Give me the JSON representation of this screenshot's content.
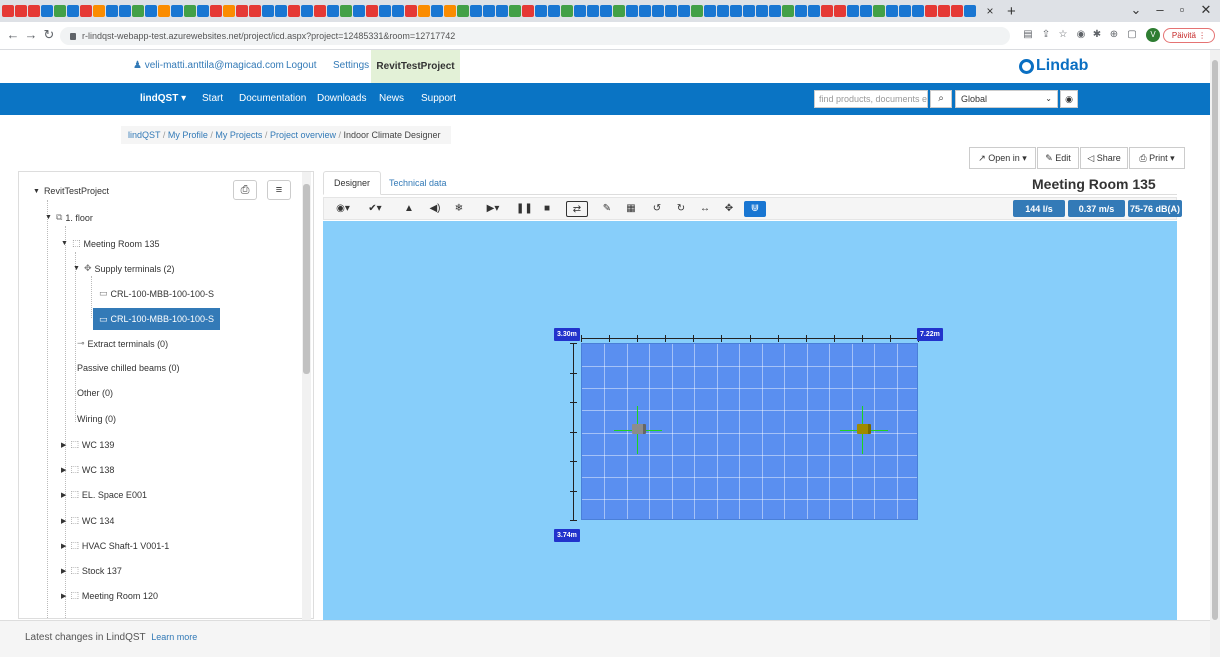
{
  "browser": {
    "url": "r-lindqst-webapp-test.azurewebsites.net/project/icd.aspx?project=12485331&room=12717742",
    "tab_close": "×",
    "new_tab": "+",
    "update_label": "Päivitä",
    "avatar_letter": "V",
    "tab_icon_colors": [
      "#e53935",
      "#e53935",
      "#e53935",
      "#1976d2",
      "#43a047",
      "#1976d2",
      "#e53935",
      "#fb8c00",
      "#1976d2",
      "#1976d2",
      "#43a047",
      "#1976d2",
      "#fb8c00",
      "#1976d2",
      "#43a047",
      "#1976d2",
      "#e53935",
      "#fb8c00",
      "#e53935",
      "#e53935",
      "#1976d2",
      "#1976d2",
      "#e53935",
      "#1976d2",
      "#e53935",
      "#1976d2",
      "#43a047",
      "#1976d2",
      "#e53935",
      "#1976d2",
      "#1976d2",
      "#e53935",
      "#fb8c00",
      "#1976d2",
      "#fb8c00",
      "#43a047",
      "#1976d2",
      "#1976d2",
      "#1976d2",
      "#43a047",
      "#e53935",
      "#1976d2",
      "#1976d2",
      "#43a047",
      "#1976d2",
      "#1976d2",
      "#1976d2",
      "#43a047",
      "#1976d2",
      "#1976d2",
      "#1976d2",
      "#1976d2",
      "#1976d2",
      "#43a047",
      "#1976d2",
      "#1976d2",
      "#1976d2",
      "#1976d2",
      "#1976d2",
      "#1976d2",
      "#43a047",
      "#1976d2",
      "#1976d2",
      "#e53935",
      "#e53935",
      "#1976d2",
      "#1976d2",
      "#43a047",
      "#1976d2",
      "#1976d2",
      "#1976d2",
      "#e53935",
      "#e53935",
      "#e53935",
      "#1976d2"
    ]
  },
  "header": {
    "user": "veli-matti.anttila@magicad.com",
    "logout": "Logout",
    "settings": "Settings",
    "project": "RevitTestProject",
    "logo": "Lindab"
  },
  "nav": {
    "brand": "lindQST ▾",
    "items": [
      "Start",
      "Documentation",
      "Downloads",
      "News",
      "Support"
    ],
    "search_placeholder": "find products, documents et",
    "region": "Global"
  },
  "breadcrumb": {
    "crumbs": [
      "lindQST",
      "My Profile",
      "My Projects",
      "Project overview"
    ],
    "active": "Indoor Climate Designer"
  },
  "actions": {
    "open_in": "Open in ▾",
    "edit": "Edit",
    "share": "Share",
    "print": "Print ▾"
  },
  "tree": {
    "root": "RevitTestProject",
    "floor": "1. floor",
    "room": "Meeting Room 135",
    "supply": "Supply terminals (2)",
    "terminal_1": "CRL-100-MBB-100-100-S",
    "terminal_2": "CRL-100-MBB-100-100-S",
    "extract": "Extract terminals (0)",
    "passive": "Passive chilled beams (0)",
    "other": "Other (0)",
    "wiring": "Wiring (0)",
    "rooms": [
      "WC 139",
      "WC 138",
      "EL. Space E001",
      "WC 134",
      "HVAC Shaft-1 V001-1",
      "Stock 137",
      "Meeting Room 120"
    ]
  },
  "designer": {
    "tab_designer": "Designer",
    "tab_technical": "Technical data",
    "title": "Meeting Room 135",
    "airflow": "144 l/s",
    "velocity": "0.37 m/s",
    "sound": "75-76 dB(A)",
    "dim_top_left": "3.30m",
    "dim_top_right": "7.22m",
    "dim_bottom_left": "3.74m",
    "colors": {
      "canvas": "#87cefa",
      "room": "#5a8ff0",
      "dimension": "#2233cc",
      "terminal_left": "#8c8c8c",
      "terminal_right": "#a08a00",
      "crosshair": "#1fd31f"
    }
  },
  "footer": {
    "text": "Latest changes in LindQST",
    "learn_more": "Learn more"
  }
}
